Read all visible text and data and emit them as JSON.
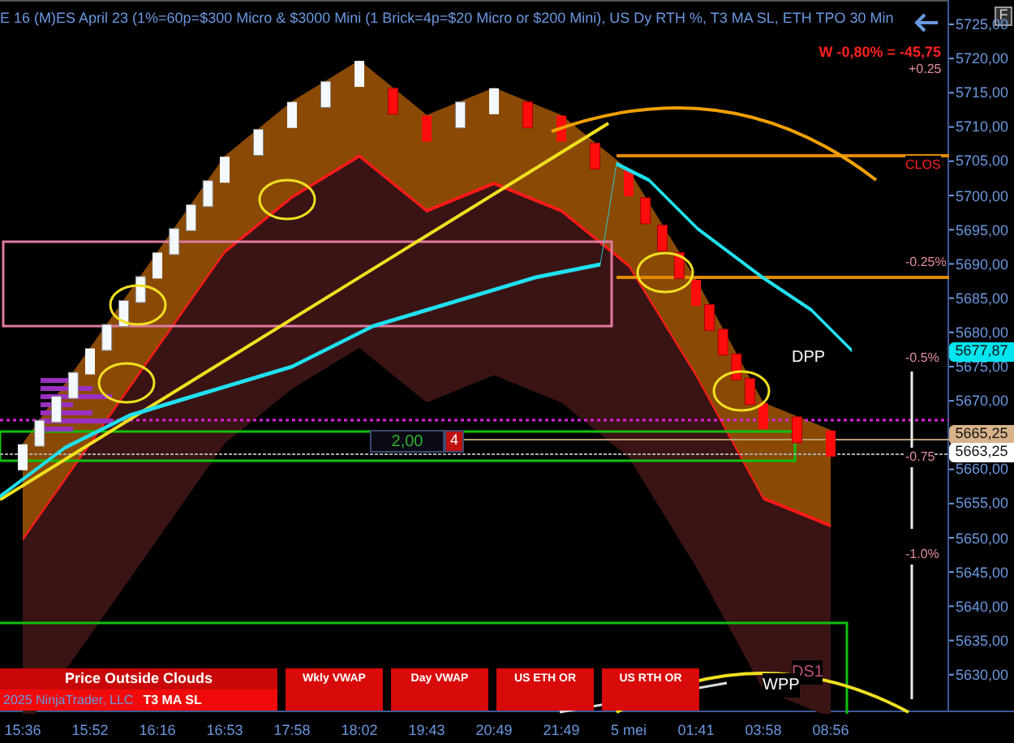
{
  "header": {
    "title": "E 16 (M)ES April 23 (1%=60p=$300 Micro & $3000 Mini  (1 Brick=4p=$20 Micro or $200 Mini), US Dy RTH %, T3 MA SL, ETH TPO 30 Min",
    "corner_button": "F"
  },
  "price_axis": [
    "5725,00",
    "5720,00",
    "5715,00",
    "5710,00",
    "5705,00",
    "5700,00",
    "5695,00",
    "5690,00",
    "5685,00",
    "5680,00",
    "5675,00",
    "5670,00",
    "5660,00",
    "5655,00",
    "5650,00",
    "5645,00",
    "5640,00",
    "5635,00",
    "5630,00"
  ],
  "time_axis": [
    "15:36",
    "15:52",
    "16:16",
    "16:53",
    "17:58",
    "18:02",
    "19:43",
    "20:49",
    "21:49",
    "5 mei",
    "01:41",
    "03:58",
    "08:56"
  ],
  "weekly_change": "W -0,80% = -45,75",
  "level_labels": [
    {
      "text": "+0.25",
      "kind": "pct"
    },
    {
      "text": "CLOS",
      "kind": "name"
    },
    {
      "text": "-0.25%",
      "kind": "pct"
    },
    {
      "text": "-0.5%",
      "kind": "pct"
    },
    {
      "text": "-0.75",
      "kind": "pct"
    },
    {
      "text": "-1.0%",
      "kind": "pct"
    }
  ],
  "price_tags": [
    {
      "text": "5677,87",
      "color": "#00e5ee"
    },
    {
      "text": "5665,25",
      "color": "#d8b38a"
    },
    {
      "text": "5663,25",
      "color": "#ffffff"
    }
  ],
  "pivots": [
    {
      "text": "DPP",
      "kind": "white"
    },
    {
      "text": "DS1",
      "kind": "pink"
    },
    {
      "text": "WPP",
      "kind": "white"
    }
  ],
  "order_box": {
    "quantity": "2,00",
    "count": "4"
  },
  "panels": [
    {
      "label": "Price Outside Clouds",
      "sub": "T3 MA SL"
    },
    {
      "label": "Wkly VWAP"
    },
    {
      "label": "Day VWAP"
    },
    {
      "label": "US ETH OR"
    },
    {
      "label": "US RTH OR"
    }
  ],
  "copyright": "2025 NinjaTrader, LLC"
}
